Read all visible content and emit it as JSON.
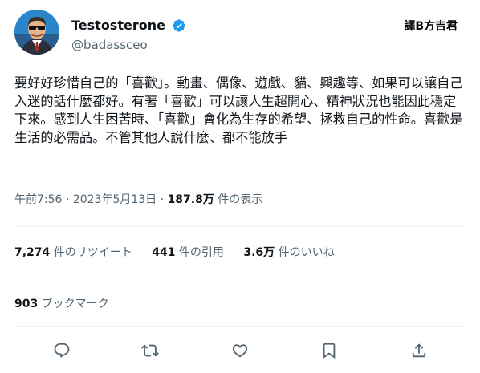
{
  "author": {
    "display_name": "Testosterone",
    "handle": "@badassceo",
    "verified_icon": "verified-badge-icon",
    "brand_color": "#1d9bf0"
  },
  "watermark": "譯B方吉君",
  "tweet": {
    "text": "要好好珍惜自己的「喜歡」。動畫、偶像、遊戲、貓、興趣等、如果可以讓自己入迷的話什麼都好。有著「喜歡」可以讓人生超開心、精神狀況也能因此穩定下來。感到人生困苦時、「喜歡」會化為生存的希望、拯救自己的性命。喜歡是生活的必需品。不管其他人說什麼、都不能放手",
    "time": "午前7:56",
    "date": "2023年5月13日",
    "views_count": "187.8万",
    "views_label": "件の表示"
  },
  "stats": {
    "retweets_count": "7,274",
    "retweets_label": "件のリツイート",
    "quotes_count": "441",
    "quotes_label": "件の引用",
    "likes_count": "3.6万",
    "likes_label": "件のいいね",
    "bookmarks_count": "903",
    "bookmarks_label": "ブックマーク"
  },
  "actions": [
    "reply-icon",
    "retweet-icon",
    "like-icon",
    "bookmark-icon",
    "share-icon"
  ]
}
